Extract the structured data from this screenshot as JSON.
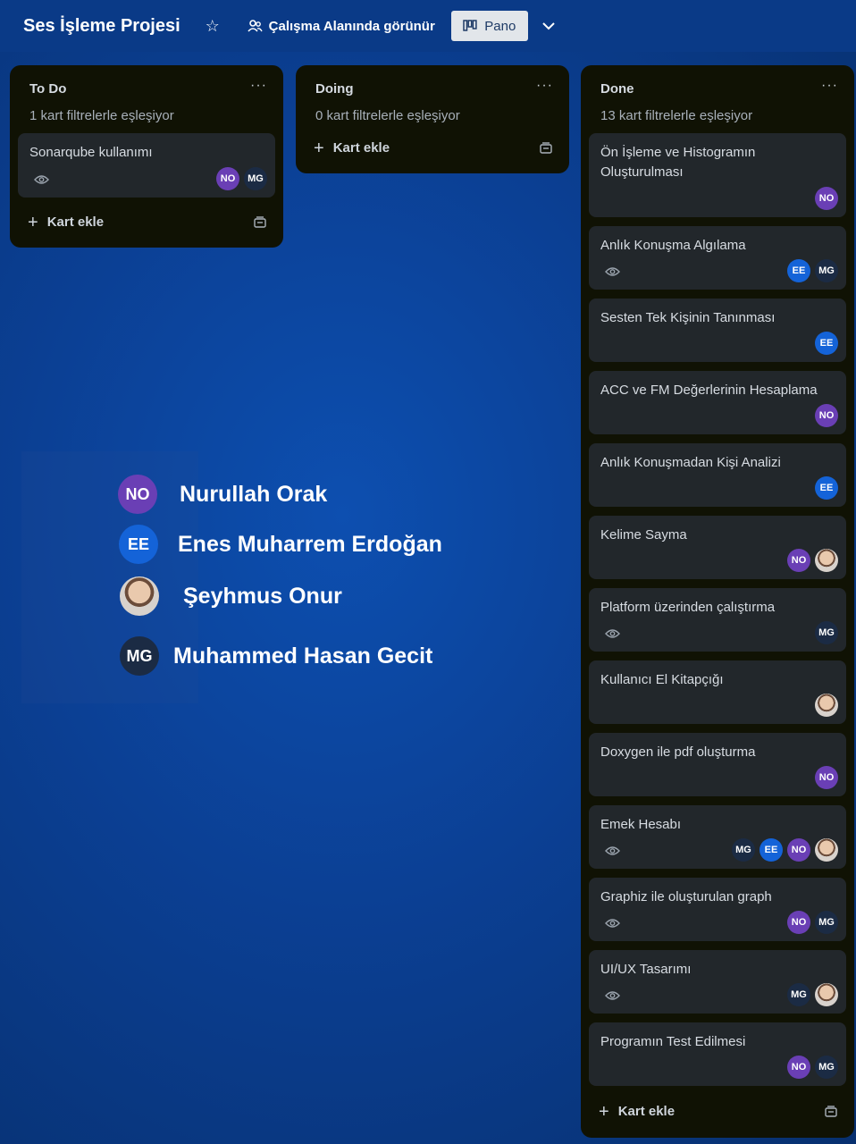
{
  "header": {
    "title": "Ses İşleme Projesi",
    "visibility_label": "Çalışma Alanında görünür",
    "view_label": "Pano"
  },
  "lists": {
    "todo": {
      "title": "To Do",
      "subtitle": "1 kart filtrelerle eşleşiyor",
      "menu": "···",
      "add_label": "Kart ekle",
      "cards": [
        {
          "title": "Sonarqube kullanımı",
          "members": [
            "NO",
            "MG"
          ]
        }
      ]
    },
    "doing": {
      "title": "Doing",
      "subtitle": "0 kart filtrelerle eşleşiyor",
      "menu": "···",
      "add_label": "Kart ekle",
      "cards": []
    },
    "done": {
      "title": "Done",
      "subtitle": "13 kart filtrelerle eşleşiyor",
      "menu": "···",
      "add_label": "Kart ekle",
      "cards": [
        {
          "title": "Ön İşleme ve Histogramın Oluşturulması",
          "members": [
            "NO"
          ]
        },
        {
          "title": "Anlık Konuşma Algılama",
          "members": [
            "EE",
            "MG"
          ]
        },
        {
          "title": "Sesten Tek Kişinin Tanınması",
          "members": [
            "EE"
          ]
        },
        {
          "title": "ACC ve FM Değerlerinin Hesaplama",
          "members": [
            "NO"
          ]
        },
        {
          "title": "Anlık Konuşmadan Kişi Analizi",
          "members": [
            "EE"
          ]
        },
        {
          "title": "Kelime Sayma",
          "members": [
            "NO",
            "photo"
          ]
        },
        {
          "title": "Platform üzerinden çalıştırma",
          "members": [
            "MG"
          ]
        },
        {
          "title": "Kullanıcı El Kitapçığı",
          "members": [
            "photo"
          ]
        },
        {
          "title": "Doxygen ile pdf oluşturma",
          "members": [
            "NO"
          ]
        },
        {
          "title": "Emek Hesabı",
          "members": [
            "MG",
            "EE",
            "NO",
            "photo"
          ]
        },
        {
          "title": "Graphiz ile oluşturulan graph",
          "members": [
            "NO",
            "MG"
          ]
        },
        {
          "title": "UI/UX Tasarımı",
          "members": [
            "MG",
            "photo"
          ]
        },
        {
          "title": "Programın Test Edilmesi",
          "members": [
            "NO",
            "MG"
          ]
        }
      ]
    }
  },
  "legend": [
    {
      "initials": "NO",
      "name": "Nurullah Orak"
    },
    {
      "initials": "EE",
      "name": "Enes Muharrem Erdoğan"
    },
    {
      "initials": "",
      "name": "Şeyhmus Onur"
    },
    {
      "initials": "MG",
      "name": "Muhammed Hasan Gecit"
    }
  ],
  "colors": {
    "no": "#6a3fb5",
    "ee": "#1463d8",
    "mg": "#1b2b44",
    "list_bg": "#101204",
    "card_bg": "#22272b"
  }
}
